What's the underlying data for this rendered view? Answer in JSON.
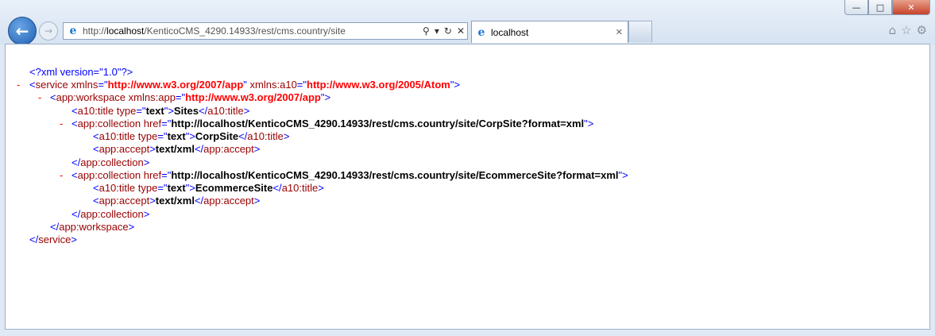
{
  "window": {
    "min_glyph": "—",
    "max_glyph": "□",
    "close_glyph": "✕"
  },
  "toolbar": {
    "back_glyph": "←",
    "forward_glyph": "→",
    "url_prefix": "http://",
    "url_host": "localhost",
    "url_path": "/KenticoCMS_4290.14933/rest/cms.country/site",
    "search_glyph": "⚲",
    "dropdown_glyph": "▾",
    "refresh_glyph": "↻",
    "stop_glyph": "✕",
    "home_glyph": "⌂",
    "favorites_glyph": "☆",
    "settings_glyph": "⚙"
  },
  "tab": {
    "title": "localhost",
    "close_glyph": "✕"
  },
  "icons": {
    "ie": "e"
  },
  "xml": {
    "decl": "<?xml version=\"1.0\"?>",
    "minus": "-",
    "lt": "<",
    "gt": ">",
    "close_lt": "</",
    "eq_q": "=\"",
    "q": "\"",
    "service_tag": "service",
    "xmlns_attr": "xmlns",
    "service_xmlns": "http://www.w3.org/2007/app",
    "xmlns_a10_attr": "xmlns:a10",
    "service_a10": "http://www.w3.org/2005/Atom",
    "workspace_tag": "app:workspace",
    "xmlns_app_attr": "xmlns:app",
    "workspace_xmlns": "http://www.w3.org/2007/app",
    "title_tag": "a10:title",
    "type_attr": "type",
    "type_value": "text",
    "sites_text": "Sites",
    "collection_tag": "app:collection",
    "href_attr": "href",
    "corp_href": "http://localhost/KenticoCMS_4290.14933/rest/cms.country/site/CorpSite?format=xml",
    "corp_title": "CorpSite",
    "accept_tag": "app:accept",
    "accept_value": "text/xml",
    "ecom_href": "http://localhost/KenticoCMS_4290.14933/rest/cms.country/site/EcommerceSite?format=xml",
    "ecom_title": "EcommerceSite"
  }
}
